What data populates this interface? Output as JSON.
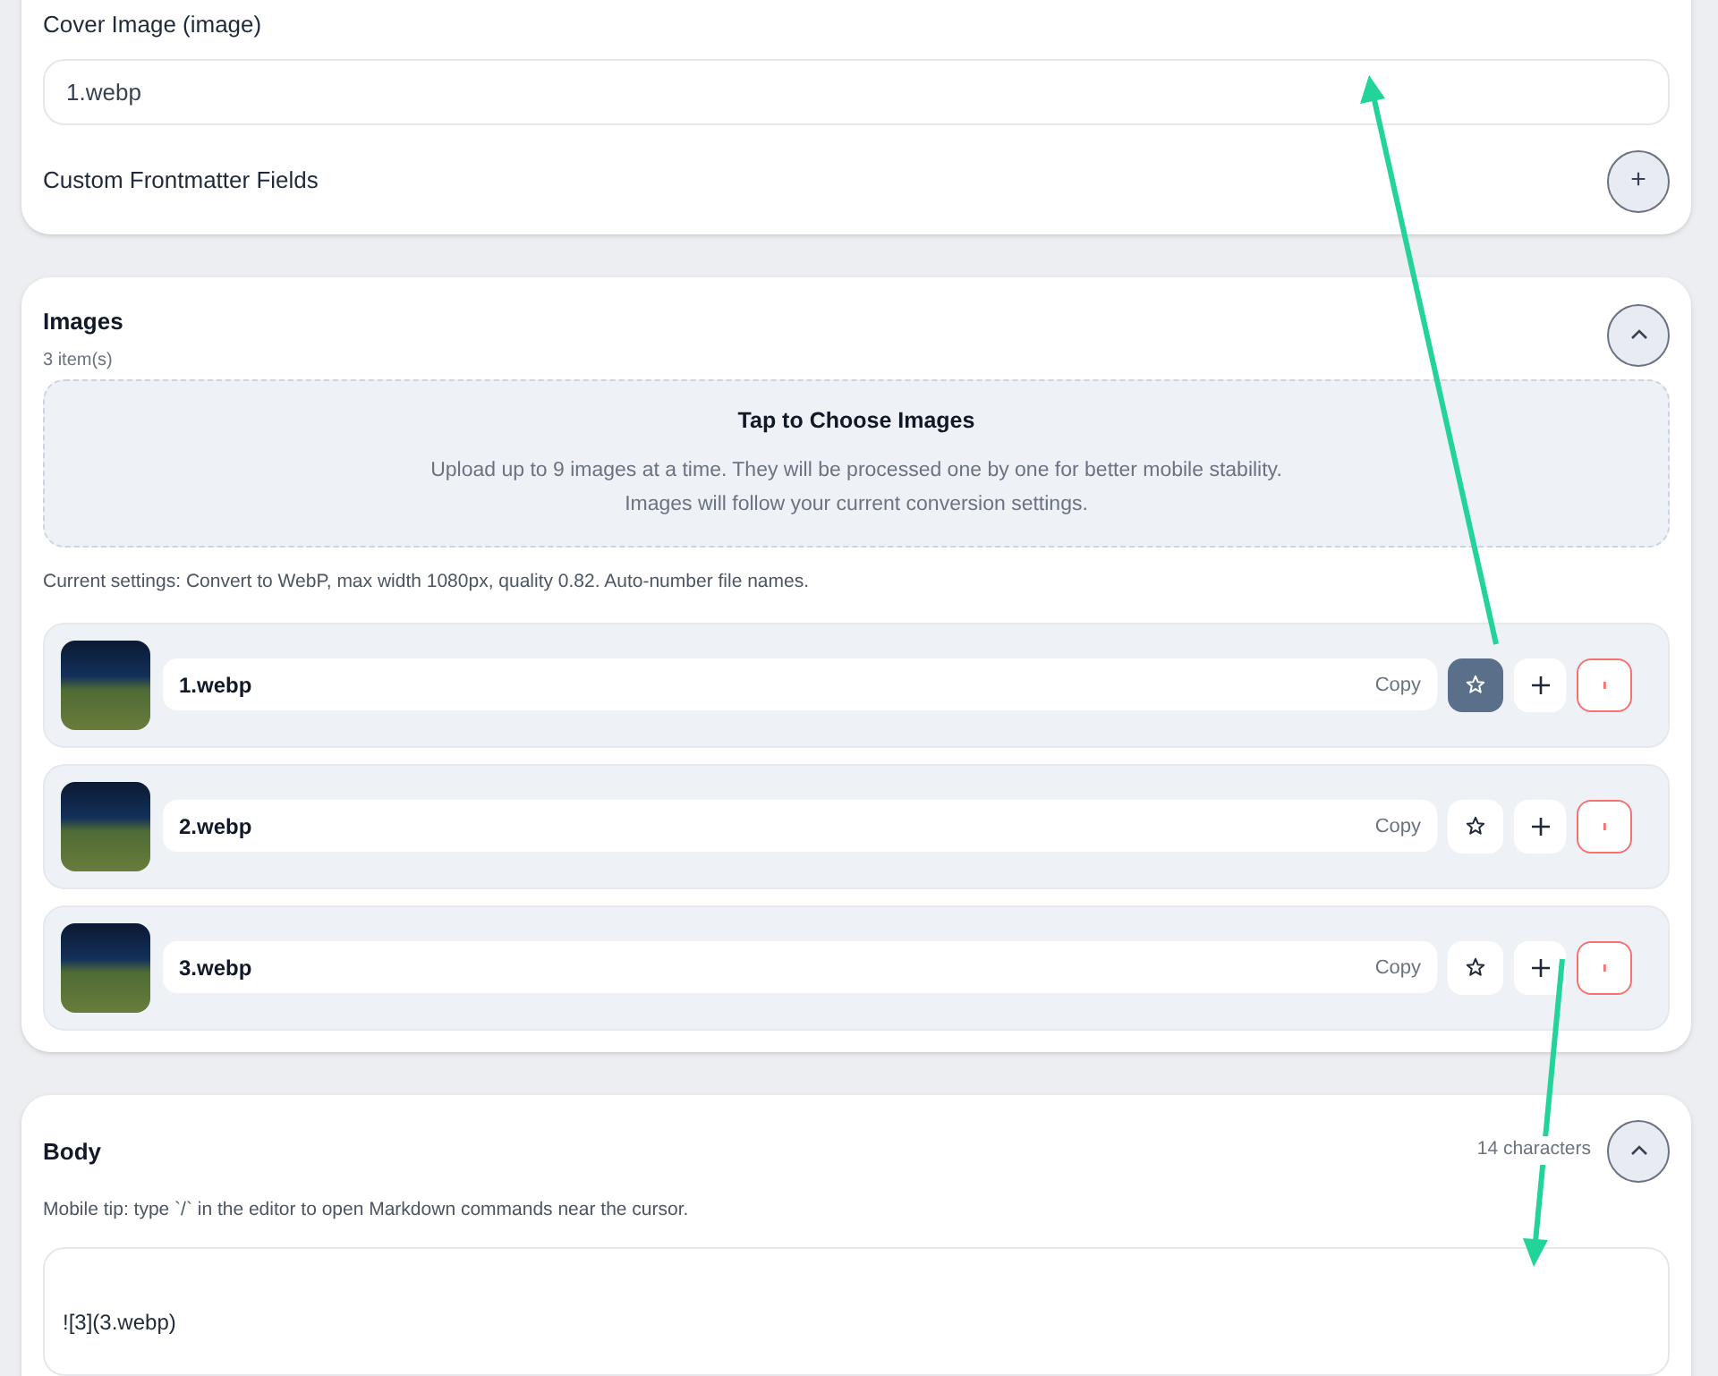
{
  "cover_image": {
    "label": "Cover Image (image)",
    "value": "1.webp"
  },
  "custom_fields": {
    "label": "Custom Frontmatter Fields",
    "add_icon": "+"
  },
  "images": {
    "title": "Images",
    "count": "3 item(s)",
    "expanded": true,
    "dropzone": {
      "title": "Tap to Choose Images",
      "lines": [
        "Upload up to 9 images at a time. They will be processed one by one for better mobile stability.",
        "Images will follow your current conversion settings."
      ]
    },
    "settings_note": "Current settings: Convert to WebP, max width 1080px, quality 0.82. Auto-number file names.",
    "items": [
      {
        "name": "1.webp",
        "copy": "Copy",
        "cover": true
      },
      {
        "name": "2.webp",
        "copy": "Copy",
        "cover": false
      },
      {
        "name": "3.webp",
        "copy": "Copy",
        "cover": false
      }
    ]
  },
  "body": {
    "title": "Body",
    "count": "14 characters",
    "expanded": true,
    "tip": "Mobile tip: type `/` in the editor to open Markdown commands near the cursor.",
    "content": "![3](3.webp)"
  }
}
